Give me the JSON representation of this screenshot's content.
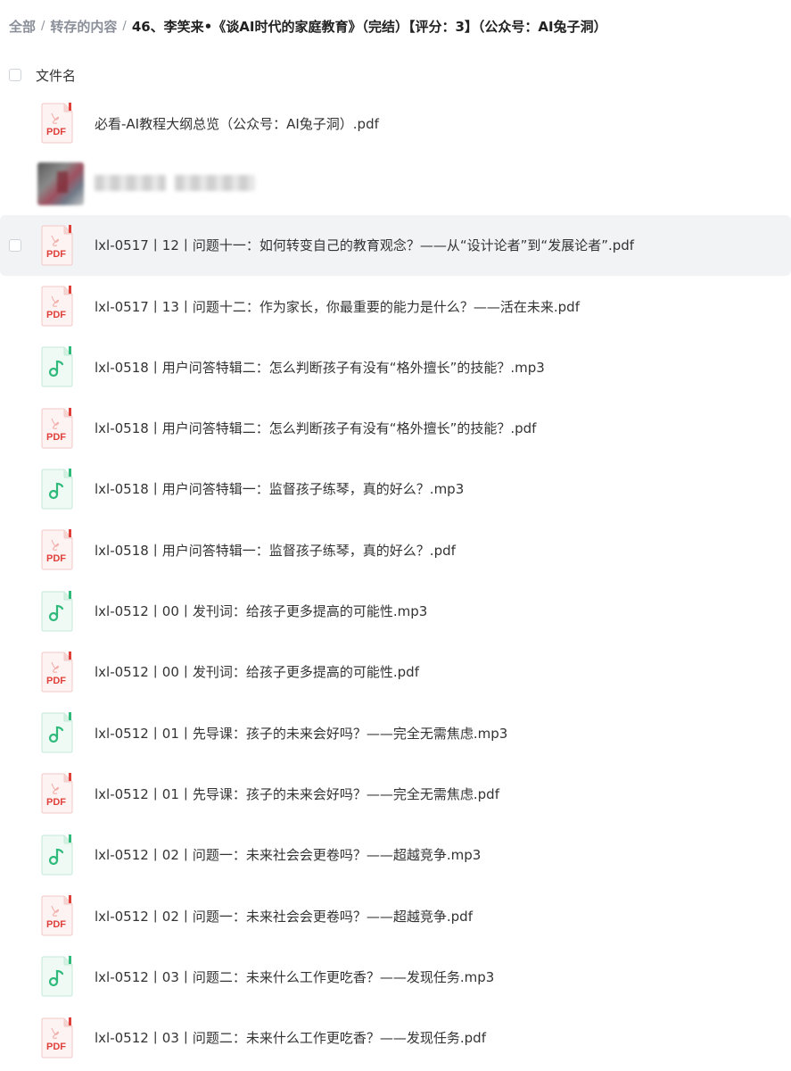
{
  "breadcrumb": {
    "root": "全部",
    "parent": "转存的内容",
    "separator": "/",
    "current": "46、李笑来•《谈AI时代的家庭教育》（完结）【评分：3】（公众号：AI兔子洞）"
  },
  "header": {
    "column_label": "文件名"
  },
  "colors": {
    "pdf": "#e0403a",
    "audio": "#2fba7c",
    "hover_row": "#f2f3f5"
  },
  "files": [
    {
      "type": "pdf",
      "icon": "pdf-icon",
      "name": "必看-AI教程大纲总览（公众号：AI兔子洞）.pdf"
    },
    {
      "type": "image",
      "icon": "image-thumbnail",
      "name": ""
    },
    {
      "type": "pdf",
      "icon": "pdf-icon",
      "name": "lxl-0517丨12丨问题十一：如何转变自己的教育观念？——从“设计论者”到“发展论者”.pdf",
      "hover": true
    },
    {
      "type": "pdf",
      "icon": "pdf-icon",
      "name": "lxl-0517丨13丨问题十二：作为家长，你最重要的能力是什么？——活在未来.pdf"
    },
    {
      "type": "audio",
      "icon": "audio-icon",
      "name": "lxl-0518丨用户问答特辑二：怎么判断孩子有没有“格外擅长”的技能？.mp3"
    },
    {
      "type": "pdf",
      "icon": "pdf-icon",
      "name": "lxl-0518丨用户问答特辑二：怎么判断孩子有没有“格外擅长”的技能？.pdf"
    },
    {
      "type": "audio",
      "icon": "audio-icon",
      "name": "lxl-0518丨用户问答特辑一：监督孩子练琴，真的好么？.mp3"
    },
    {
      "type": "pdf",
      "icon": "pdf-icon",
      "name": "lxl-0518丨用户问答特辑一：监督孩子练琴，真的好么？.pdf"
    },
    {
      "type": "audio",
      "icon": "audio-icon",
      "name": "lxl-0512丨00丨发刊词：给孩子更多提高的可能性.mp3"
    },
    {
      "type": "pdf",
      "icon": "pdf-icon",
      "name": "lxl-0512丨00丨发刊词：给孩子更多提高的可能性.pdf"
    },
    {
      "type": "audio",
      "icon": "audio-icon",
      "name": "lxl-0512丨01丨先导课：孩子的未来会好吗？——完全无需焦虑.mp3"
    },
    {
      "type": "pdf",
      "icon": "pdf-icon",
      "name": "lxl-0512丨01丨先导课：孩子的未来会好吗？——完全无需焦虑.pdf"
    },
    {
      "type": "audio",
      "icon": "audio-icon",
      "name": "lxl-0512丨02丨问题一：未来社会会更卷吗？——超越竞争.mp3"
    },
    {
      "type": "pdf",
      "icon": "pdf-icon",
      "name": "lxl-0512丨02丨问题一：未来社会会更卷吗？——超越竞争.pdf"
    },
    {
      "type": "audio",
      "icon": "audio-icon",
      "name": "lxl-0512丨03丨问题二：未来什么工作更吃香？——发现任务.mp3"
    },
    {
      "type": "pdf",
      "icon": "pdf-icon",
      "name": "lxl-0512丨03丨问题二：未来什么工作更吃香？——发现任务.pdf"
    }
  ]
}
